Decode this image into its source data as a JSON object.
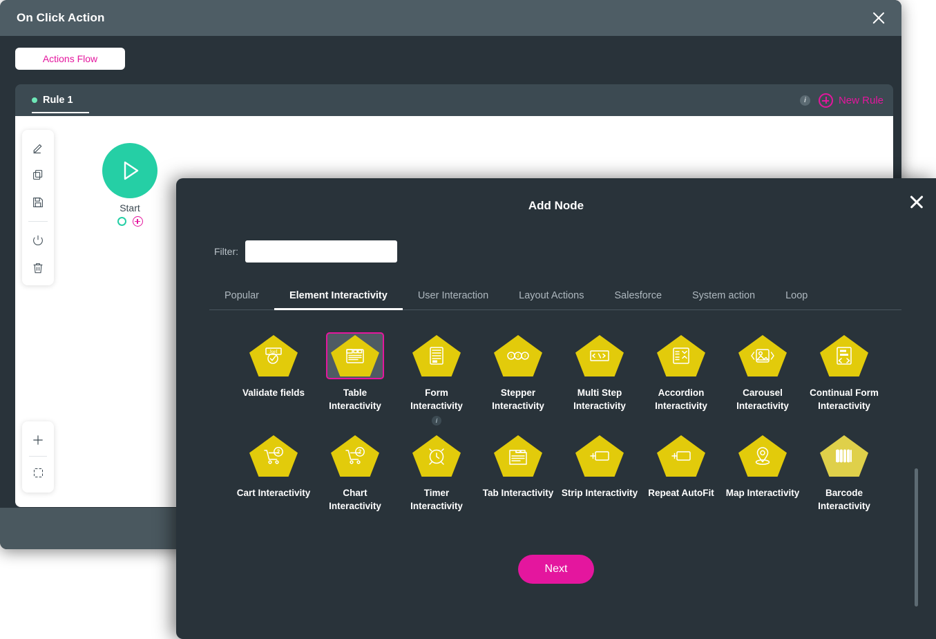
{
  "action_modal": {
    "title": "On Click Action",
    "close_icon": "close-icon",
    "actions_flow_label": "Actions Flow",
    "rule_tab": {
      "label": "Rule 1",
      "status_dot_color": "#6ee7b7"
    },
    "info_badge": "i",
    "new_rule_label": "New Rule",
    "toolbar": [
      {
        "name": "edit-icon"
      },
      {
        "name": "copy-icon"
      },
      {
        "name": "save-icon"
      },
      {
        "name": "power-icon"
      },
      {
        "name": "trash-icon"
      }
    ],
    "zoom_tools": [
      {
        "name": "zoom-in-icon"
      },
      {
        "name": "fit-screen-icon"
      }
    ],
    "start_node": {
      "label": "Start",
      "icon": "play-icon"
    }
  },
  "add_node": {
    "title": "Add Node",
    "close_icon": "close-icon",
    "filter": {
      "label": "Filter:",
      "value": "",
      "placeholder": ""
    },
    "tabs": [
      {
        "label": "Popular",
        "active": false
      },
      {
        "label": "Element Interactivity",
        "active": true
      },
      {
        "label": "User Interaction",
        "active": false
      },
      {
        "label": "Layout Actions",
        "active": false
      },
      {
        "label": "Salesforce",
        "active": false
      },
      {
        "label": "System action",
        "active": false
      },
      {
        "label": "Loop",
        "active": false
      }
    ],
    "nodes": [
      {
        "label": "Validate fields",
        "icon": "validate-fields-icon",
        "selected": false,
        "info": false
      },
      {
        "label": "Table Interactivity",
        "icon": "table-icon",
        "selected": true,
        "info": false
      },
      {
        "label": "Form Interactivity",
        "icon": "form-icon",
        "selected": false,
        "info": true
      },
      {
        "label": "Stepper Interactivity",
        "icon": "stepper-icon",
        "selected": false,
        "info": false
      },
      {
        "label": "Multi Step Interactivity",
        "icon": "code-icon",
        "selected": false,
        "info": false
      },
      {
        "label": "Accordion Interactivity",
        "icon": "accordion-icon",
        "selected": false,
        "info": false
      },
      {
        "label": "Carousel Interactivity",
        "icon": "carousel-icon",
        "selected": false,
        "info": false
      },
      {
        "label": "Continual Form Interactivity",
        "icon": "continual-form-icon",
        "selected": false,
        "info": false
      },
      {
        "label": "Cart Interactivity",
        "icon": "cart-icon",
        "selected": false,
        "info": false
      },
      {
        "label": "Chart Interactivity",
        "icon": "cart-icon",
        "selected": false,
        "info": false
      },
      {
        "label": "Timer Interactivity",
        "icon": "timer-icon",
        "selected": false,
        "info": false
      },
      {
        "label": "Tab Interactivity",
        "icon": "tab-icon",
        "selected": false,
        "info": false
      },
      {
        "label": "Strip Interactivity",
        "icon": "strip-icon",
        "selected": false,
        "info": false
      },
      {
        "label": "Repeat AutoFit",
        "icon": "repeat-autofit-icon",
        "selected": false,
        "info": false
      },
      {
        "label": "Map Interactivity",
        "icon": "map-pin-icon",
        "selected": false,
        "info": false
      },
      {
        "label": "Barcode Interactivity",
        "icon": "barcode-icon",
        "selected": false,
        "info": false
      }
    ],
    "info_badge": "i",
    "next_label": "Next"
  },
  "colors": {
    "accent_magenta": "#e4169e",
    "node_yellow": "#e2cb0b",
    "start_teal": "#25cfa5",
    "modal_bg": "#29333a",
    "header_bg": "#4e5d65"
  }
}
